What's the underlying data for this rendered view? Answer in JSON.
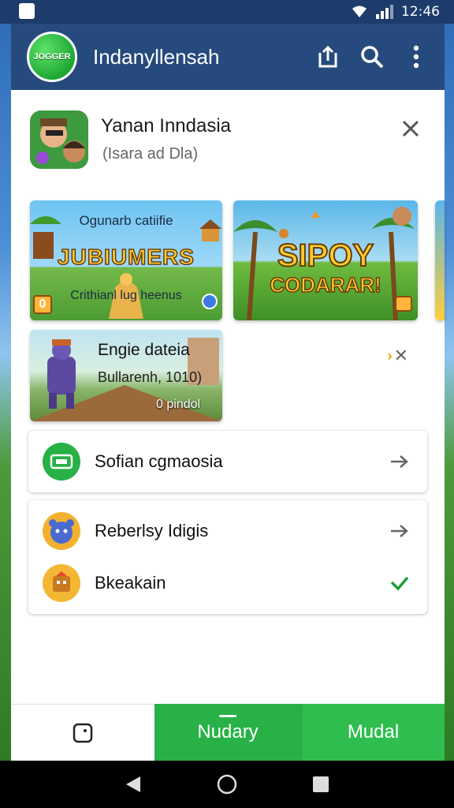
{
  "status_bar": {
    "time": "12:46"
  },
  "app_bar": {
    "logo_text": "JOGGER",
    "title": "Indanyllensah",
    "actions": [
      "share-icon",
      "search-icon",
      "more-vert-icon"
    ]
  },
  "app_header": {
    "name": "Yanan Inndasia",
    "subtitle": "(Isara ad Dla)"
  },
  "screenshots": [
    {
      "top_text": "Ogunarb catiifie",
      "headline": "JUBIUMERS",
      "bottom_text": "Crithianl lug heenus",
      "corner_badge": "0"
    },
    {
      "headline_1": "SIPOY",
      "headline_2": "CODARAR!"
    }
  ],
  "promo": {
    "title": "Engie dateia",
    "subtitle": "Bullarenh, 1010)",
    "tag": "0 pindol",
    "chevron": "›",
    "close": "✕"
  },
  "card_1": {
    "label": "Sofian cgmaosia",
    "icon": "ticket-icon",
    "trail_icon": "arrow-icon"
  },
  "card_2": {
    "rows": [
      {
        "label": "Reberlsy Idigis",
        "icon": "bear-icon",
        "trail_icon": "arrow-icon"
      },
      {
        "label": "Bkeakain",
        "icon": "robot-icon",
        "trail_icon": "check-icon"
      }
    ]
  },
  "bottom_nav": {
    "tabs": [
      {
        "label": "",
        "icon": "square-icon"
      },
      {
        "label": "Nudary"
      },
      {
        "label": "Mudal"
      }
    ]
  },
  "colors": {
    "app_bar": "#264a7d",
    "accent_green": "#27b146",
    "check_green": "#1f9e3d"
  }
}
